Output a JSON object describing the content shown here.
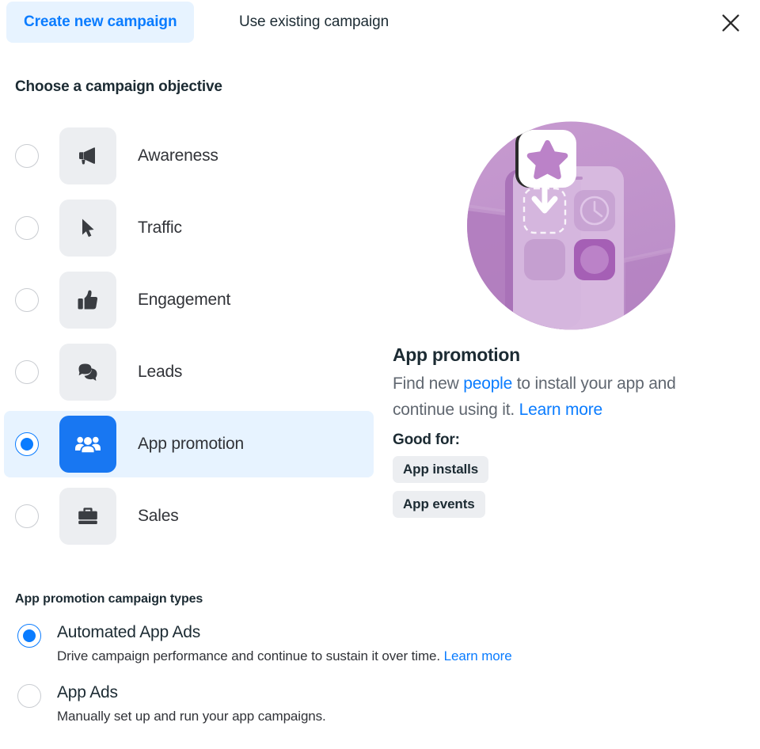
{
  "tabs": [
    {
      "label": "Create new campaign",
      "active": true
    },
    {
      "label": "Use existing campaign",
      "active": false
    }
  ],
  "close_label": "Close",
  "headings": {
    "objective": "Choose a campaign objective",
    "campaign_types": "App promotion campaign types"
  },
  "objectives": [
    {
      "label": "Awareness",
      "icon": "megaphone-icon",
      "selected": false
    },
    {
      "label": "Traffic",
      "icon": "cursor-icon",
      "selected": false
    },
    {
      "label": "Engagement",
      "icon": "thumbs-up-icon",
      "selected": false
    },
    {
      "label": "Leads",
      "icon": "chat-bubble-icon",
      "selected": false
    },
    {
      "label": "App promotion",
      "icon": "people-icon",
      "selected": true
    },
    {
      "label": "Sales",
      "icon": "briefcase-icon",
      "selected": false
    }
  ],
  "detail": {
    "illustration": "app-download-illustration",
    "title": "App promotion",
    "desc_part1": "Find new ",
    "desc_link1": "people",
    "desc_part2": " to install your app and continue using it. ",
    "desc_link2": "Learn more",
    "good_for_label": "Good for:",
    "tags": [
      "App installs",
      "App events"
    ]
  },
  "campaign_types": [
    {
      "title": "Automated App Ads",
      "description": "Drive campaign performance and continue to sustain it over time. ",
      "link": "Learn more",
      "selected": true
    },
    {
      "title": "App Ads",
      "description": "Manually set up and run your app campaigns.",
      "link": "",
      "selected": false
    }
  ],
  "colors": {
    "accent_blue": "#0a7cff",
    "icon_blue": "#1877f2",
    "selected_row_bg": "#e7f3ff",
    "icon_tile_bg": "#eceef1",
    "text_primary": "#1c2b33",
    "text_secondary": "#606770",
    "illustration_purple": "#b98cc4"
  }
}
